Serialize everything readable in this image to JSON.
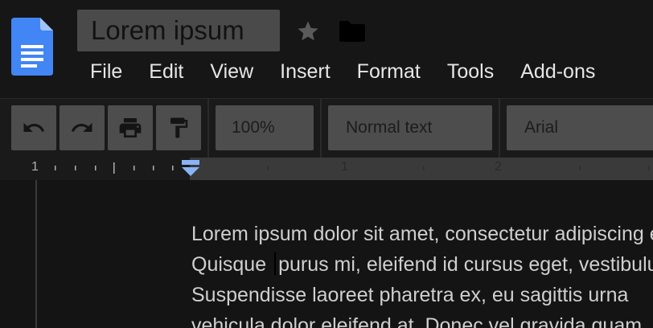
{
  "document": {
    "title": "Lorem ipsum"
  },
  "menu": {
    "items": [
      "File",
      "Edit",
      "View",
      "Insert",
      "Format",
      "Tools",
      "Add-ons"
    ]
  },
  "toolbar": {
    "zoom": "100%",
    "style": "Normal text",
    "font": "Arial"
  },
  "ruler": {
    "labels": [
      "1",
      "1",
      "2"
    ]
  },
  "body": {
    "lines": [
      "Lorem ipsum dolor sit amet, consectetur adipiscing elit.",
      [
        "Quisque ",
        "purus mi, eleifend id cursus eget, vestibulum"
      ],
      "Suspendisse laoreet pharetra ex, eu sagittis urna",
      "vehicula dolor eleifend at. Donec vel gravida quam."
    ]
  },
  "colors": {
    "background": "#141414",
    "control": "#4d4d4d",
    "ruler_active": "#3a3a3a",
    "indent_marker": "#8ab4f8",
    "doc_icon": "#4285f4"
  },
  "icons": {
    "logo": "docs-logo-icon",
    "star": "star-icon",
    "folder": "folder-icon",
    "undo": "undo-icon",
    "redo": "redo-icon",
    "print": "print-icon",
    "paint_format": "paint-format-icon"
  }
}
